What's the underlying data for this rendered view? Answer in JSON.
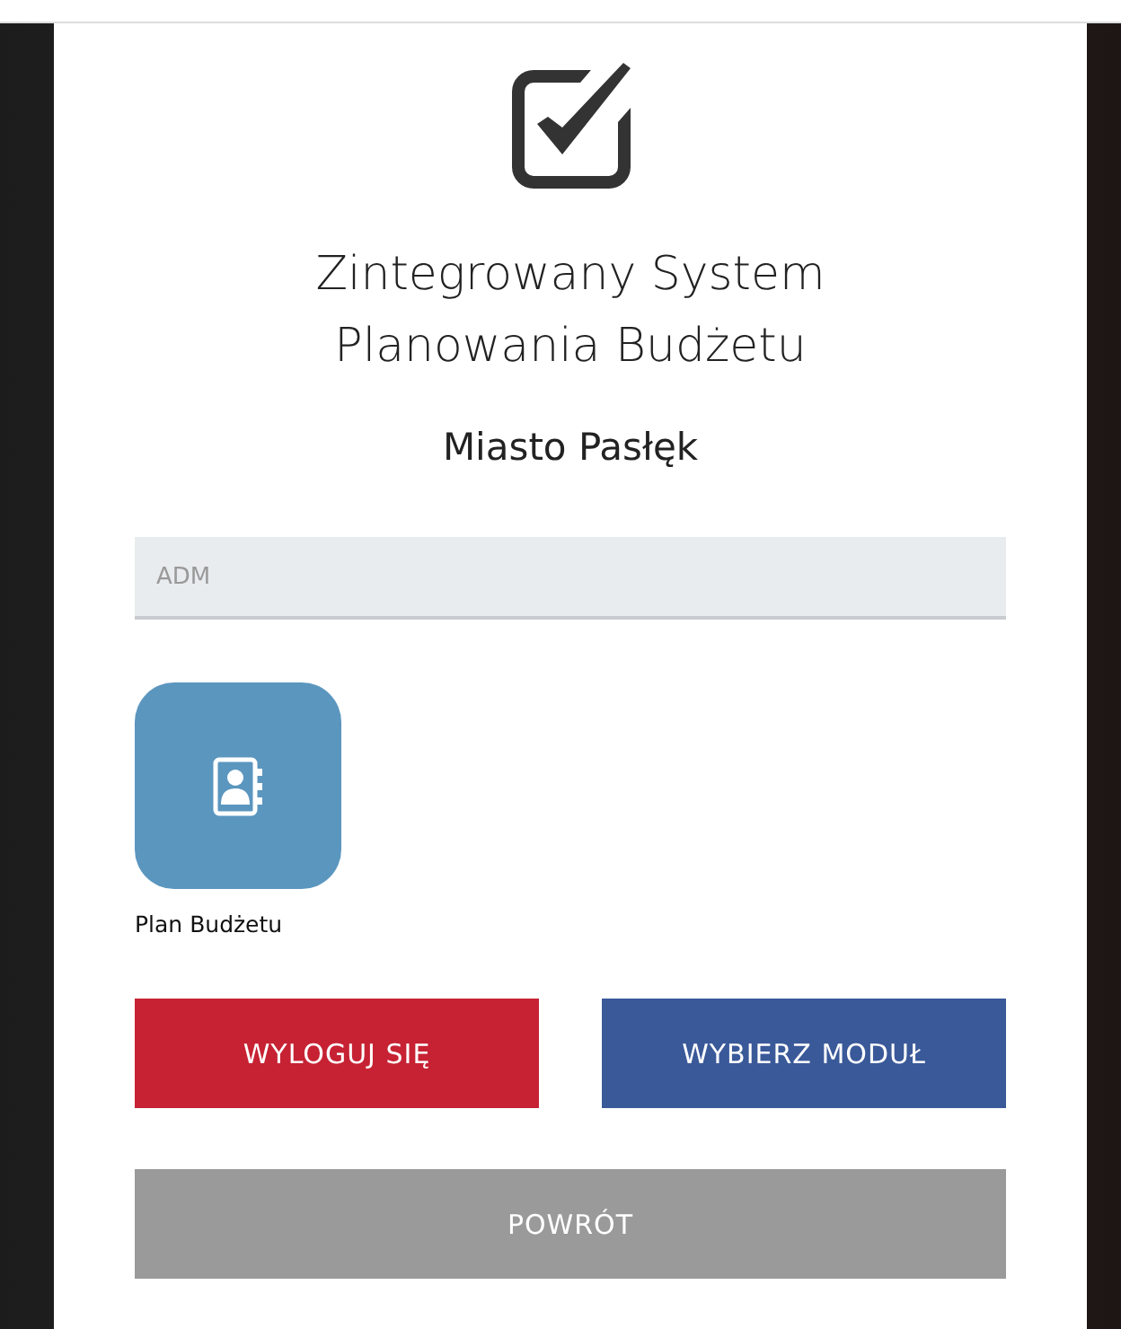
{
  "header": {
    "title_lines": [
      "Zintegrowany System",
      "Planowania Budżetu"
    ],
    "subtitle": "Miasto Pasłęk"
  },
  "user_field": {
    "placeholder": "ADM"
  },
  "modules": [
    {
      "label": "Plan Budżetu"
    }
  ],
  "buttons": [
    {
      "label": "WYLOGUJ SIĘ",
      "kind": "danger"
    },
    {
      "label": "WYBIERZ MODUŁ",
      "kind": "primary"
    },
    {
      "label": "POWRÓT",
      "kind": "secondary"
    }
  ]
}
